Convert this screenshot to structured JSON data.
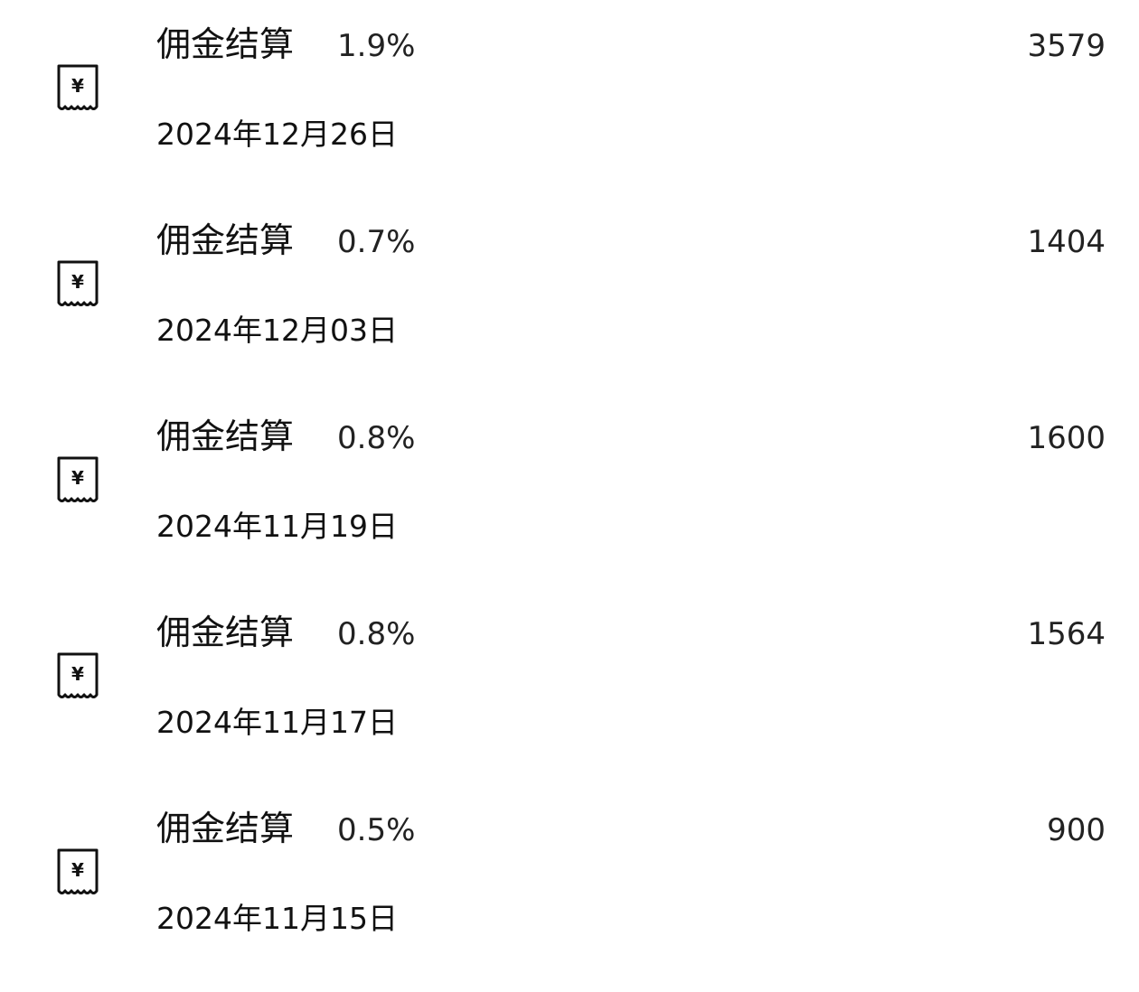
{
  "transactions": [
    {
      "icon": "receipt-yuan-icon",
      "title": "佣金结算",
      "rate": "1.9%",
      "amount": "3579",
      "date": "2024年12月26日"
    },
    {
      "icon": "receipt-yuan-icon",
      "title": "佣金结算",
      "rate": "0.7%",
      "amount": "1404",
      "date": "2024年12月03日"
    },
    {
      "icon": "receipt-yuan-icon",
      "title": "佣金结算",
      "rate": "0.8%",
      "amount": "1600",
      "date": "2024年11月19日"
    },
    {
      "icon": "receipt-yuan-icon",
      "title": "佣金结算",
      "rate": "0.8%",
      "amount": "1564",
      "date": "2024年11月17日"
    },
    {
      "icon": "receipt-yuan-icon",
      "title": "佣金结算",
      "rate": "0.5%",
      "amount": "900",
      "date": "2024年11月15日"
    }
  ]
}
